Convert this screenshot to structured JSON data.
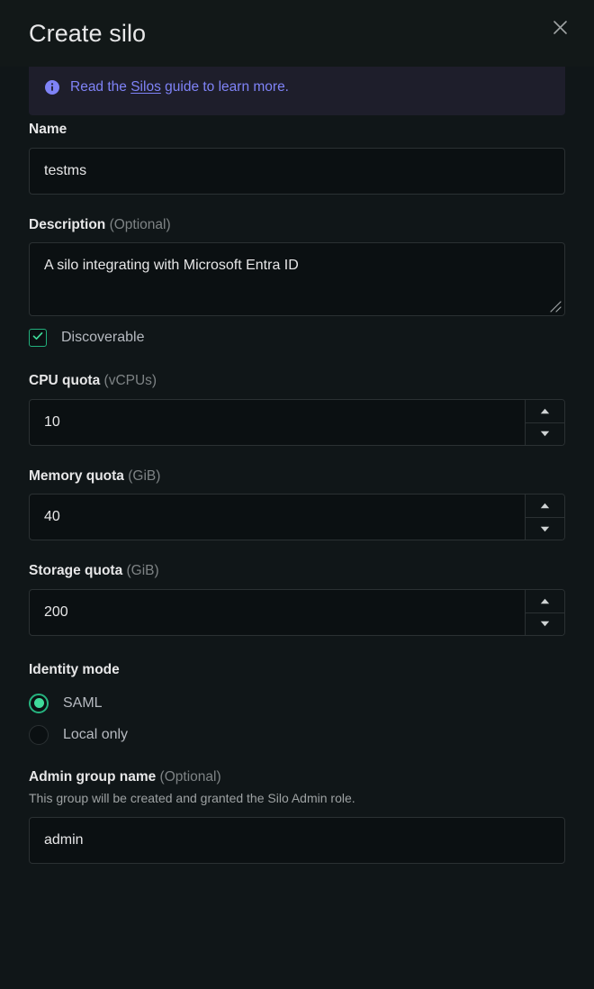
{
  "modal": {
    "title": "Create silo",
    "close_icon": "close-icon"
  },
  "banner": {
    "icon": "info-icon",
    "text_before": "Read the ",
    "link_text": "Silos",
    "text_after": " guide to learn more."
  },
  "form": {
    "name": {
      "label": "Name",
      "value": "testms",
      "placeholder": ""
    },
    "description": {
      "label": "Description ",
      "optional": "(Optional)",
      "value": "A silo integrating with Microsoft Entra ID",
      "placeholder": ""
    },
    "discoverable": {
      "label": "Discoverable",
      "checked": true,
      "check_icon": "check-icon"
    },
    "cpu_quota": {
      "label": "CPU quota ",
      "unit": "(vCPUs)",
      "value": "10",
      "increment_icon": "caret-up-icon",
      "decrement_icon": "caret-down-icon"
    },
    "memory_quota": {
      "label": "Memory quota ",
      "unit": "(GiB)",
      "value": "40",
      "increment_icon": "caret-up-icon",
      "decrement_icon": "caret-down-icon"
    },
    "storage_quota": {
      "label": "Storage quota ",
      "unit": "(GiB)",
      "value": "200",
      "increment_icon": "caret-up-icon",
      "decrement_icon": "caret-down-icon"
    },
    "identity_mode": {
      "label": "Identity mode",
      "selected": "SAML",
      "options": [
        {
          "label": "SAML",
          "checked": true
        },
        {
          "label": "Local only",
          "checked": false
        }
      ]
    },
    "admin_group": {
      "label": "Admin group name ",
      "optional": "(Optional)",
      "helper": "This group will be created and granted the Silo Admin role.",
      "value": "admin",
      "placeholder": ""
    }
  },
  "colors": {
    "background": "#101618",
    "header_background": "#121818",
    "banner_background": "#1e1e2b",
    "banner_text": "#7f83f7",
    "input_background": "#0b1012",
    "input_border": "#2b3133",
    "label_text": "#e7e7e8",
    "muted_text": "#7e8385",
    "accent_green": "#26b47f",
    "accent_green_bright": "#3fdb9a"
  }
}
